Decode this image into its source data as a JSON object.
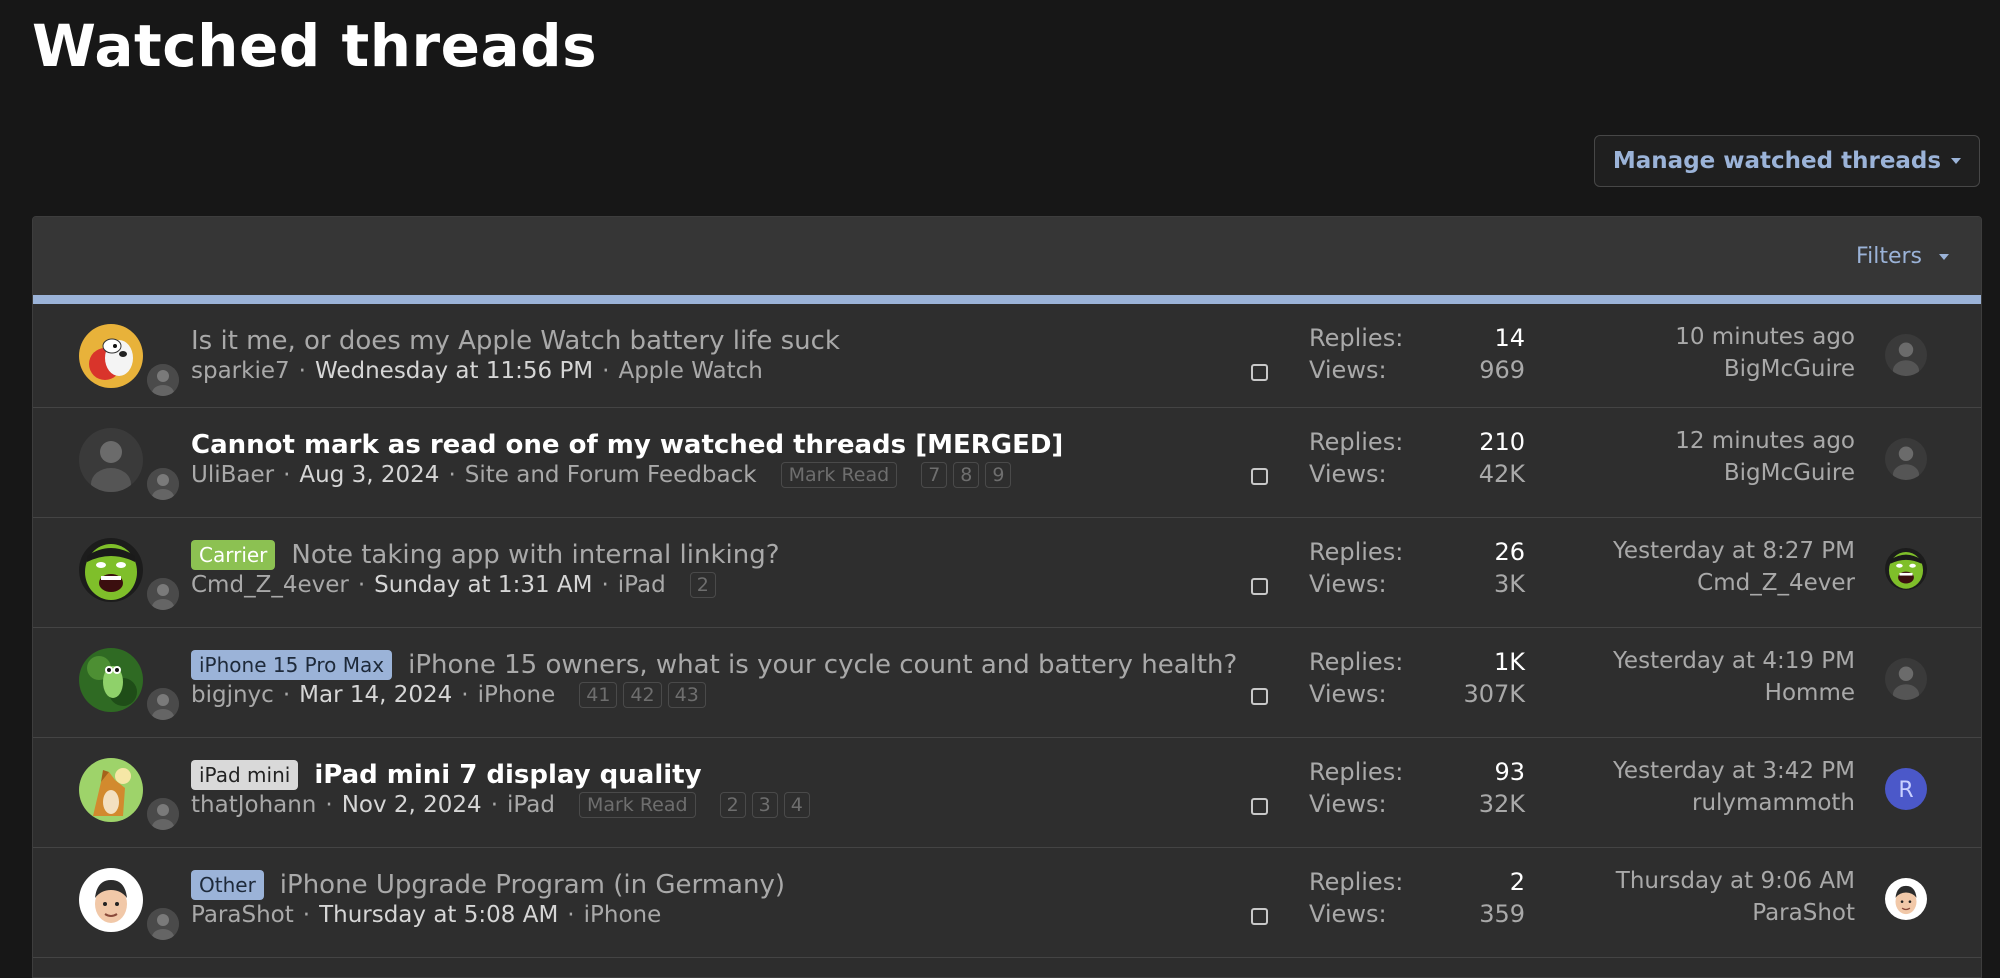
{
  "page": {
    "title": "Watched threads",
    "manage_label": "Manage watched threads",
    "filters_label": "Filters"
  },
  "colors": {
    "accent": "#9bb3d8",
    "background": "#171717",
    "row": "#2e2e2e"
  },
  "threads": [
    {
      "title": "Is it me, or does my Apple Watch battery life suck",
      "prefix": "",
      "unread": false,
      "author": "sparkie7",
      "date": "Wednesday at 11:56 PM",
      "forum": "Apple Watch",
      "mark_read": "",
      "pages": [],
      "replies_label": "Replies:",
      "replies": "14",
      "views_label": "Views:",
      "views": "969",
      "last_time": "10 minutes ago",
      "last_user": "BigMcGuire",
      "avatar_icon": "cartoon-dog-avatar-icon",
      "last_avatar_icon": "user-photo-avatar-icon"
    },
    {
      "title": "Cannot mark as read one of my watched threads [MERGED]",
      "prefix": "",
      "unread": true,
      "author": "UliBaer",
      "date": "Aug 3, 2024",
      "forum": "Site and Forum Feedback",
      "mark_read": "Mark Read",
      "pages": [
        "7",
        "8",
        "9"
      ],
      "replies_label": "Replies:",
      "replies": "210",
      "views_label": "Views:",
      "views": "42K",
      "last_time": "12 minutes ago",
      "last_user": "BigMcGuire",
      "avatar_icon": "user-photo-avatar-icon",
      "last_avatar_icon": "user-photo-avatar-icon"
    },
    {
      "title": "Note taking app with internal linking?",
      "prefix": "Carrier",
      "prefix_bg": "#8cc152",
      "prefix_fg": "#ffffff",
      "unread": false,
      "author": "Cmd_Z_4ever",
      "date": "Sunday at 1:31 AM",
      "forum": "iPad",
      "mark_read": "",
      "pages": [
        "2"
      ],
      "replies_label": "Replies:",
      "replies": "26",
      "views_label": "Views:",
      "views": "3K",
      "last_time": "Yesterday at 8:27 PM",
      "last_user": "Cmd_Z_4ever",
      "avatar_icon": "hulk-avatar-icon",
      "last_avatar_icon": "hulk-avatar-icon"
    },
    {
      "title": "iPhone 15 owners, what is your cycle count and battery health?",
      "prefix": "iPhone 15 Pro Max",
      "prefix_bg": "#9bb3d8",
      "prefix_fg": "#1e2a3a",
      "unread": false,
      "author": "bigjnyc",
      "date": "Mar 14, 2024",
      "forum": "iPhone",
      "mark_read": "",
      "pages": [
        "41",
        "42",
        "43"
      ],
      "replies_label": "Replies:",
      "replies": "1K",
      "views_label": "Views:",
      "views": "307K",
      "last_time": "Yesterday at 4:19 PM",
      "last_user": "Homme",
      "avatar_icon": "frog-avatar-icon",
      "last_avatar_icon": "user-photo-avatar-icon"
    },
    {
      "title": "iPad mini 7 display quality",
      "prefix": "iPad mini",
      "prefix_bg": "#d9d9d9",
      "prefix_fg": "#222222",
      "unread": true,
      "author": "thatJohann",
      "date": "Nov 2, 2024",
      "forum": "iPad",
      "mark_read": "Mark Read",
      "pages": [
        "2",
        "3",
        "4"
      ],
      "replies_label": "Replies:",
      "replies": "93",
      "views_label": "Views:",
      "views": "32K",
      "last_time": "Yesterday at 3:42 PM",
      "last_user": "rulymammoth",
      "avatar_icon": "wolf-avatar-icon",
      "last_avatar_icon": "letter-r-avatar-icon",
      "last_avatar_letter": "R"
    },
    {
      "title": "iPhone Upgrade Program (in Germany)",
      "prefix": "Other",
      "prefix_bg": "#9bb3d8",
      "prefix_fg": "#1e2a3a",
      "unread": false,
      "author": "ParaShot",
      "date": "Thursday at 5:08 AM",
      "forum": "iPhone",
      "mark_read": "",
      "pages": [],
      "replies_label": "Replies:",
      "replies": "2",
      "views_label": "Views:",
      "views": "359",
      "last_time": "Thursday at 9:06 AM",
      "last_user": "ParaShot",
      "avatar_icon": "memoji-avatar-icon",
      "last_avatar_icon": "memoji-avatar-icon"
    }
  ]
}
